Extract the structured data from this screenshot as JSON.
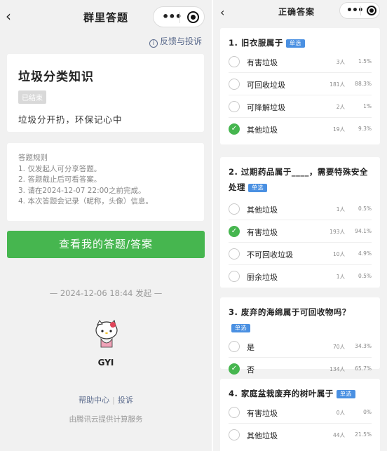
{
  "left": {
    "nav_back": "‹",
    "nav_title": "群里答题",
    "capsule_dots": "•••",
    "feedback": "反馈与投诉",
    "quiz_title": "垃圾分类知识",
    "status_badge": "已结束",
    "quiz_desc": "垃圾分开扔，环保记心中",
    "rules_title": "答题规则",
    "rules": [
      "1. 仅发起人可分享答题。",
      "2. 答题截止后可看答案。",
      "3. 请在2024-12-07 22:00之前完成。",
      "4. 本次答题会记录（昵称，头像）信息。"
    ],
    "view_button": "查看我的答题/答案",
    "launched": "— 2024-12-06 18:44 发起 —",
    "username": "GYI",
    "help_center": "帮助中心",
    "complaint": "投诉",
    "powered_by": "由腾讯云提供计算服务"
  },
  "right": {
    "nav_back": "‹",
    "nav_title": "正确答案",
    "capsule_dots": "•••",
    "tag_single": "单选",
    "questions": [
      {
        "title": "1. 旧衣服属于",
        "options": [
          {
            "text": "有害垃圾",
            "count": "3人",
            "pct": "1.5%",
            "correct": false
          },
          {
            "text": "可回收垃圾",
            "count": "181人",
            "pct": "88.3%",
            "correct": false
          },
          {
            "text": "可降解垃圾",
            "count": "2人",
            "pct": "1%",
            "correct": false
          },
          {
            "text": "其他垃圾",
            "count": "19人",
            "pct": "9.3%",
            "correct": true
          }
        ]
      },
      {
        "title": "2. 过期药品属于____，需要特殊安全处理",
        "options": [
          {
            "text": "其他垃圾",
            "count": "1人",
            "pct": "0.5%",
            "correct": false
          },
          {
            "text": "有害垃圾",
            "count": "193人",
            "pct": "94.1%",
            "correct": true
          },
          {
            "text": "不可回收垃圾",
            "count": "10人",
            "pct": "4.9%",
            "correct": false
          },
          {
            "text": "厨余垃圾",
            "count": "1人",
            "pct": "0.5%",
            "correct": false
          }
        ]
      },
      {
        "title": "3. 废弃的海绵属于可回收物吗？",
        "options": [
          {
            "text": "是",
            "count": "70人",
            "pct": "34.3%",
            "correct": false
          },
          {
            "text": "否",
            "count": "134人",
            "pct": "65.7%",
            "correct": true
          }
        ]
      },
      {
        "title": "4. 家庭盆栽废弃的树叶属于",
        "options": [
          {
            "text": "有害垃圾",
            "count": "0人",
            "pct": "0%",
            "correct": false
          },
          {
            "text": "其他垃圾",
            "count": "44人",
            "pct": "21.5%",
            "correct": false
          }
        ]
      }
    ]
  },
  "colors": {
    "accent_green": "#46b64f",
    "tag_blue": "#4a90e2",
    "link_blue": "#5a6a8c"
  }
}
